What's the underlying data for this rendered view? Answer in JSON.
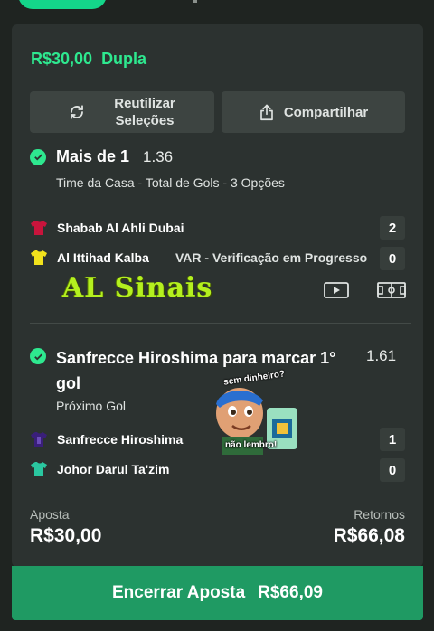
{
  "bet": {
    "stake_header": "R$30,00",
    "type": "Dupla"
  },
  "actions": {
    "reuse_line1": "Reutilizar",
    "reuse_line2": "Seleções",
    "share": "Compartilhar"
  },
  "selection1": {
    "title": "Mais de 1",
    "odds": "1.36",
    "market": "Time da Casa - Total de Gols - 3 Opções",
    "home_team": "Shabab Al Ahli Dubai",
    "home_score": "2",
    "home_shirt_color": "#c8143c",
    "away_team": "Al Ittihad Kalba",
    "away_score": "0",
    "away_shirt_color": "#f2e21c",
    "status": "VAR - Verificação em Progresso",
    "icons": [
      "play-video-icon",
      "pitch-icon"
    ]
  },
  "watermark": "AL Sinais",
  "selection2": {
    "title": "Sanfrecce Hiroshima para marcar 1° gol",
    "odds": "1.61",
    "market": "Próximo Gol",
    "home_team": "Sanfrecce Hiroshima",
    "home_score": "1",
    "home_shirt_color": "#3a1f7a",
    "away_team": "Johor Darul Ta'zim",
    "away_score": "0",
    "away_shirt_color": "#2ac7a0"
  },
  "sticker": {
    "top_text": "sem dinheiro?",
    "bottom_text": "não lembro!"
  },
  "summary": {
    "stake_label": "Aposta",
    "stake_value": "R$30,00",
    "returns_label": "Retornos",
    "returns_value": "R$66,08"
  },
  "cashout": {
    "label": "Encerrar Aposta",
    "value": "R$66,09"
  },
  "colors": {
    "accent": "#2ee88f",
    "cashout_bg": "#1f9a63",
    "card_bg": "#2c3230",
    "page_bg": "#1f2421"
  }
}
